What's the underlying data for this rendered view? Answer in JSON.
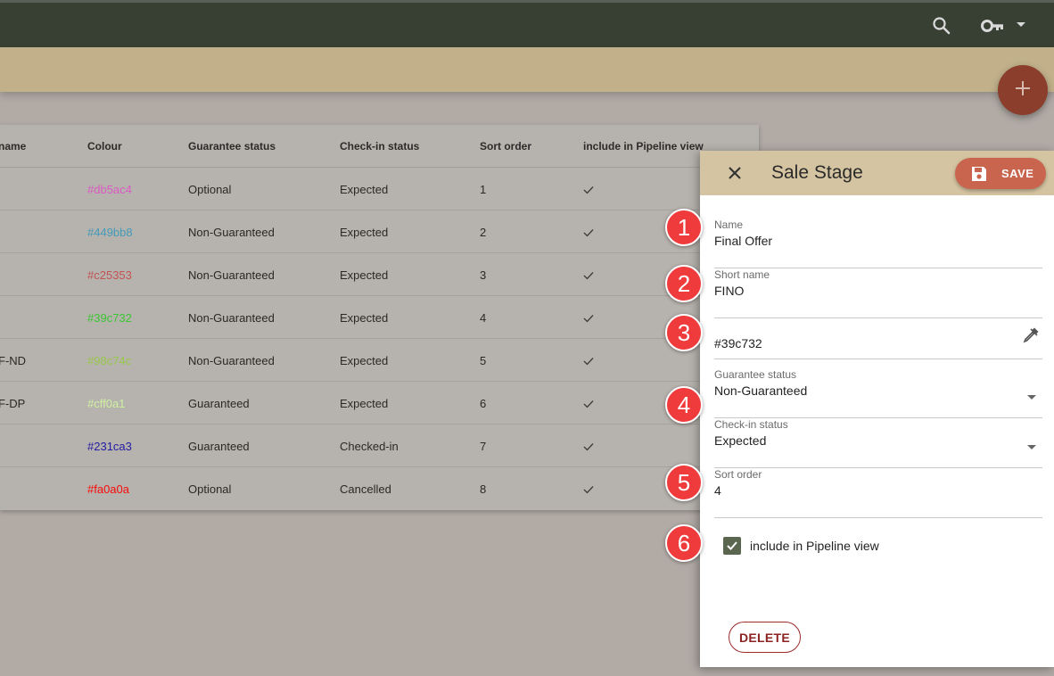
{
  "topbar": {
    "icons": [
      "search-icon",
      "key-icon",
      "dropdown-caret-icon"
    ]
  },
  "fab": {
    "icon": "plus-icon"
  },
  "table": {
    "columns": [
      "name",
      "Colour",
      "Guarantee status",
      "Check-in status",
      "Sort order",
      "include in Pipeline view"
    ],
    "rows": [
      {
        "short": "",
        "colour": "#db5ac4",
        "guarantee": "Optional",
        "checkin": "Expected",
        "sort": "1",
        "pipeline": true
      },
      {
        "short": "",
        "colour": "#449bb8",
        "guarantee": "Non-Guaranteed",
        "checkin": "Expected",
        "sort": "2",
        "pipeline": true
      },
      {
        "short": "",
        "colour": "#c25353",
        "guarantee": "Non-Guaranteed",
        "checkin": "Expected",
        "sort": "3",
        "pipeline": true
      },
      {
        "short": "",
        "colour": "#39c732",
        "guarantee": "Non-Guaranteed",
        "checkin": "Expected",
        "sort": "4",
        "pipeline": true
      },
      {
        "short": "F-ND",
        "colour": "#98c74c",
        "guarantee": "Non-Guaranteed",
        "checkin": "Expected",
        "sort": "5",
        "pipeline": true
      },
      {
        "short": "F-DP",
        "colour": "#cff0a1",
        "guarantee": "Guaranteed",
        "checkin": "Expected",
        "sort": "6",
        "pipeline": true
      },
      {
        "short": "",
        "colour": "#231ca3",
        "guarantee": "Guaranteed",
        "checkin": "Checked-in",
        "sort": "7",
        "pipeline": true
      },
      {
        "short": "",
        "colour": "#fa0a0a",
        "guarantee": "Optional",
        "checkin": "Cancelled",
        "sort": "8",
        "pipeline": true
      }
    ]
  },
  "panel": {
    "title": "Sale Stage",
    "save_label": "SAVE",
    "delete_label": "DELETE",
    "fields": {
      "name": {
        "label": "Name",
        "value": "Final Offer"
      },
      "short_name": {
        "label": "Short name",
        "value": "FINO"
      },
      "colour": {
        "value": "#39c732"
      },
      "guarantee": {
        "label": "Guarantee status",
        "value": "Non-Guaranteed"
      },
      "checkin": {
        "label": "Check-in status",
        "value": "Expected"
      },
      "sort_order": {
        "label": "Sort order",
        "value": "4"
      }
    },
    "pipeline": {
      "label": "include in Pipeline view",
      "checked": true
    }
  },
  "badges": [
    "1",
    "2",
    "3",
    "4",
    "5",
    "6"
  ],
  "colors": {
    "topbar": "#384034",
    "subbar": "#c1b08a",
    "panel_header": "#d5c4a1",
    "save_button": "#c9654f",
    "fab": "#8b3e2c",
    "badge": "#ef3b3b",
    "checkbox": "#5a6650"
  }
}
